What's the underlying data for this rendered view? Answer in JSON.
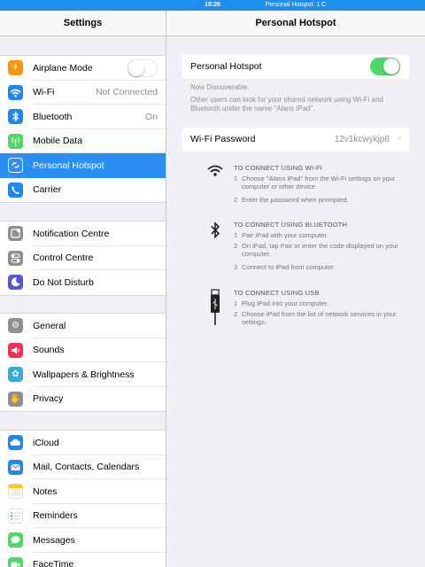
{
  "status": {
    "time": "10:26",
    "hotspot": "Personal Hotspot: 1 C"
  },
  "left": {
    "title": "Settings",
    "groups": [
      [
        {
          "label": "Airplane Mode",
          "icon": "airplane-icon",
          "color": "#ff9500",
          "toggle": "off"
        },
        {
          "label": "Wi-Fi",
          "value": "Not Connected",
          "icon": "wifi-icon",
          "color": "#1e88f0"
        },
        {
          "label": "Bluetooth",
          "value": "On",
          "icon": "bluetooth-icon",
          "color": "#1e88f0"
        },
        {
          "label": "Mobile Data",
          "icon": "antenna-icon",
          "color": "#4cd964"
        },
        {
          "label": "Personal Hotspot",
          "icon": "hotspot-icon",
          "color": "#4cd964",
          "selected": true
        },
        {
          "label": "Carrier",
          "icon": "phone-icon",
          "color": "#1e88f0"
        }
      ],
      [
        {
          "label": "Notification Centre",
          "icon": "notification-icon",
          "color": "#8e8e93"
        },
        {
          "label": "Control Centre",
          "icon": "control-centre-icon",
          "color": "#8e8e93"
        },
        {
          "label": "Do Not Disturb",
          "icon": "moon-icon",
          "color": "#5856d6"
        }
      ],
      [
        {
          "label": "General",
          "icon": "gear-icon",
          "color": "#8e8e93"
        },
        {
          "label": "Sounds",
          "icon": "speaker-icon",
          "color": "#ff2d55"
        },
        {
          "label": "Wallpapers & Brightness",
          "icon": "flower-icon",
          "color": "#34aadc"
        },
        {
          "label": "Privacy",
          "icon": "hand-icon",
          "color": "#8e8e93"
        }
      ],
      [
        {
          "label": "iCloud",
          "icon": "cloud-icon",
          "color": "#1e88f0"
        },
        {
          "label": "Mail, Contacts, Calendars",
          "icon": "mail-icon",
          "color": "#1e88f0"
        },
        {
          "label": "Notes",
          "icon": "notes-icon",
          "color": "#ffcc00"
        },
        {
          "label": "Reminders",
          "icon": "reminders-icon",
          "color": "#ffffff"
        },
        {
          "label": "Messages",
          "icon": "messages-icon",
          "color": "#4cd964"
        },
        {
          "label": "FaceTime",
          "icon": "facetime-icon",
          "color": "#4cd964"
        }
      ]
    ]
  },
  "right": {
    "title": "Personal Hotspot",
    "hotspot_label": "Personal Hotspot",
    "hotspot_toggle": "on",
    "discoverable": "Now Discoverable.",
    "description": "Other users can look for your shared network using Wi-Fi and Bluetooth under the name \"Alans iPad\".",
    "wifi_password_label": "Wi-Fi Password",
    "wifi_password_value": "12v1kcwykjp8",
    "instructions": [
      {
        "icon": "wifi-icon",
        "heading": "TO CONNECT USING WI-FI",
        "steps": [
          {
            "n": "1",
            "text": "Choose \"Alans iPad\" from the Wi-Fi settings on your computer or other device."
          },
          {
            "n": "2",
            "text": "Enter the password when prompted."
          }
        ]
      },
      {
        "icon": "bluetooth-icon",
        "heading": "TO CONNECT USING BLUETOOTH",
        "steps": [
          {
            "n": "1",
            "text": "Pair iPad with your computer."
          },
          {
            "n": "2",
            "text": "On iPad, tap Pair or enter the code displayed on your computer."
          },
          {
            "n": "3",
            "text": "Connect to iPad from computer."
          }
        ]
      },
      {
        "icon": "usb-icon",
        "heading": "TO CONNECT USING USB",
        "steps": [
          {
            "n": "1",
            "text": "Plug iPad into your computer."
          },
          {
            "n": "2",
            "text": "Choose iPad from the list of network services in your settings."
          }
        ]
      }
    ]
  }
}
